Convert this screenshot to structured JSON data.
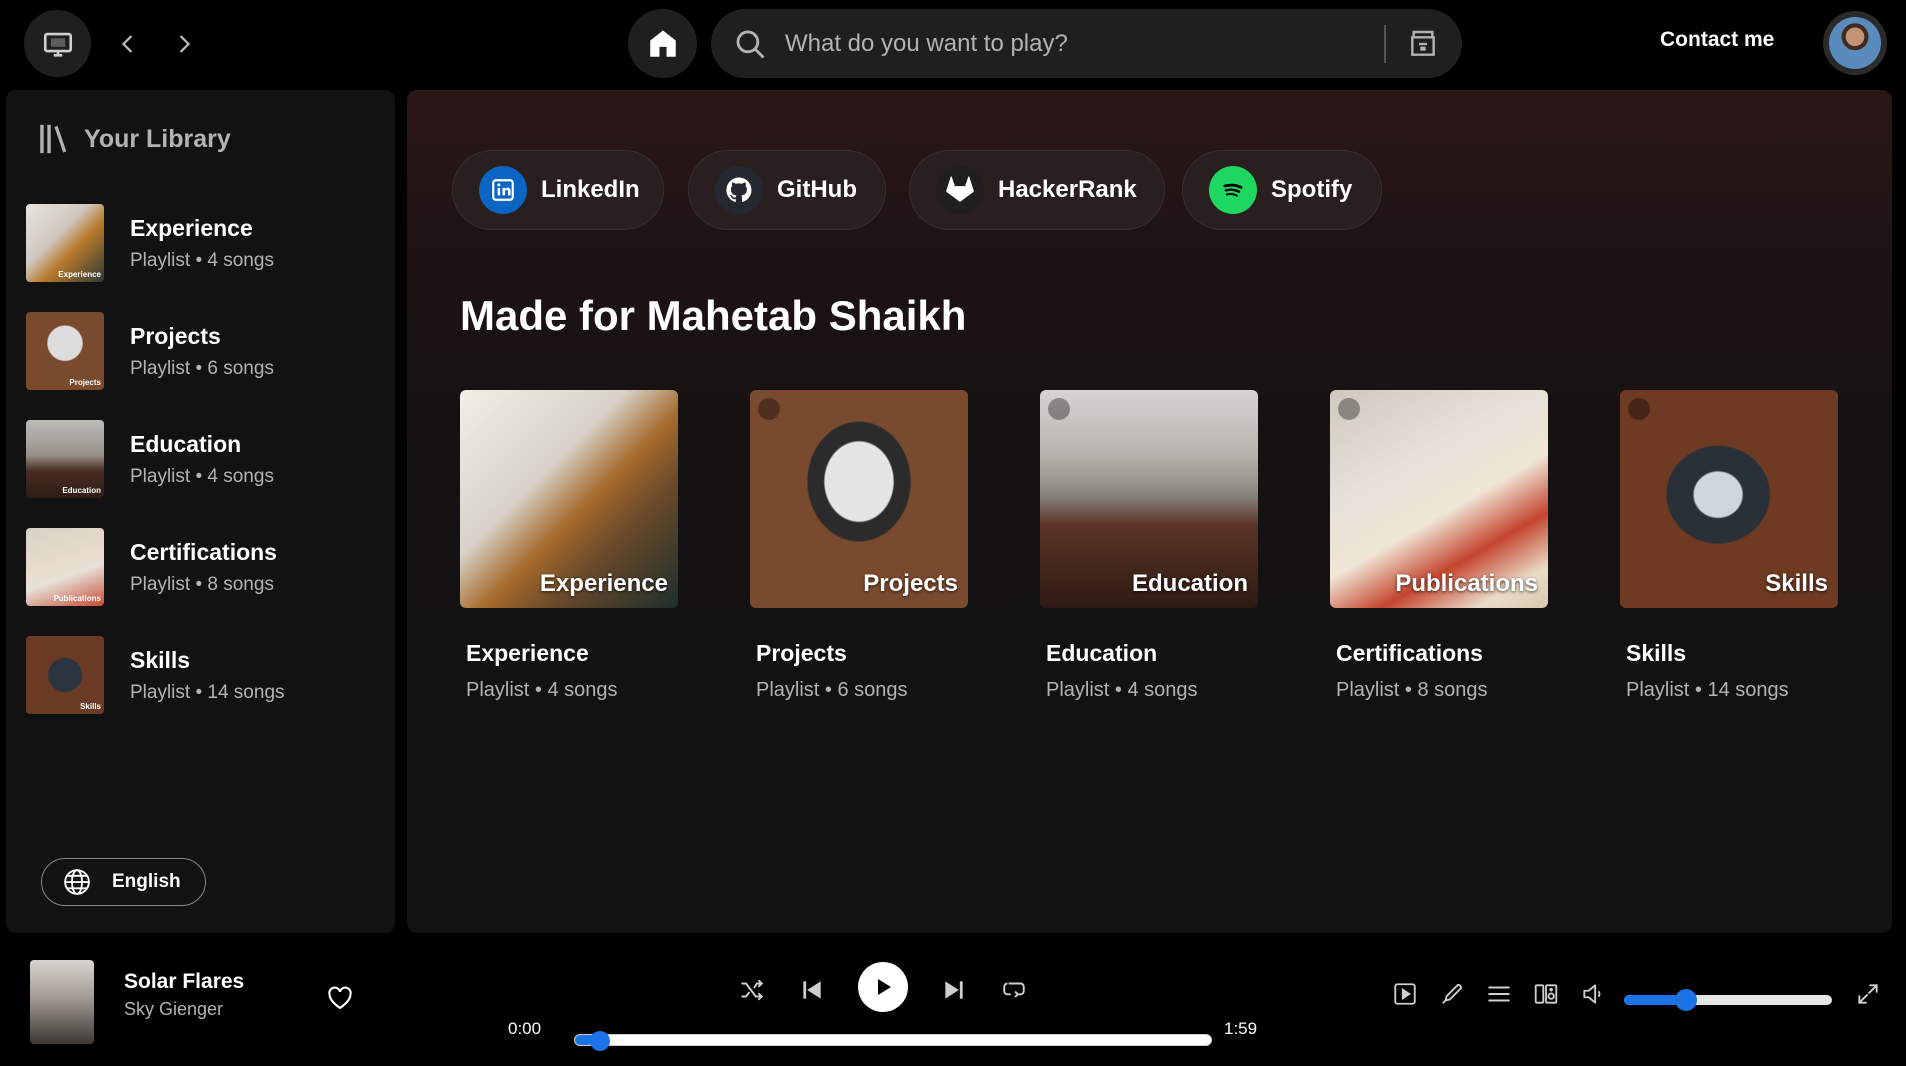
{
  "topbar": {
    "search_placeholder": "What do you want to play?",
    "contact_label": "Contact me"
  },
  "library": {
    "title": "Your Library",
    "items": [
      {
        "name": "Experience",
        "meta": "Playlist • 4 songs",
        "thumb_label": "Experience"
      },
      {
        "name": "Projects",
        "meta": "Playlist • 6 songs",
        "thumb_label": "Projects"
      },
      {
        "name": "Education",
        "meta": "Playlist • 4 songs",
        "thumb_label": "Education"
      },
      {
        "name": "Certifications",
        "meta": "Playlist • 8 songs",
        "thumb_label": "Publications"
      },
      {
        "name": "Skills",
        "meta": "Playlist • 14 songs",
        "thumb_label": "Skills"
      }
    ],
    "language_label": "English"
  },
  "main": {
    "socials": [
      {
        "label": "LinkedIn",
        "icon": "linkedin-icon",
        "color": "#0a66c2"
      },
      {
        "label": "GitHub",
        "icon": "github-icon",
        "color": "#24292f"
      },
      {
        "label": "HackerRank",
        "icon": "gitlab-icon",
        "color": "#1f1f1f"
      },
      {
        "label": "Spotify",
        "icon": "spotify-icon",
        "color": "#1ed760"
      }
    ],
    "section_title": "Made for Mahetab Shaikh",
    "cards": [
      {
        "cover_label": "Experience",
        "title": "Experience",
        "meta": "Playlist • 4 songs"
      },
      {
        "cover_label": "Projects",
        "title": "Projects",
        "meta": "Playlist • 6 songs"
      },
      {
        "cover_label": "Education",
        "title": "Education",
        "meta": "Playlist • 4 songs"
      },
      {
        "cover_label": "Publications",
        "title": "Certifications",
        "meta": "Playlist • 8 songs"
      },
      {
        "cover_label": "Skills",
        "title": "Skills",
        "meta": "Playlist • 14 songs"
      }
    ]
  },
  "player": {
    "track_title": "Solar Flares",
    "artist": "Sky Gienger",
    "time_elapsed": "0:00",
    "time_total": "1:59",
    "progress_fraction": 0.04,
    "volume_fraction": 0.3,
    "accent_color": "#1a73e8"
  }
}
